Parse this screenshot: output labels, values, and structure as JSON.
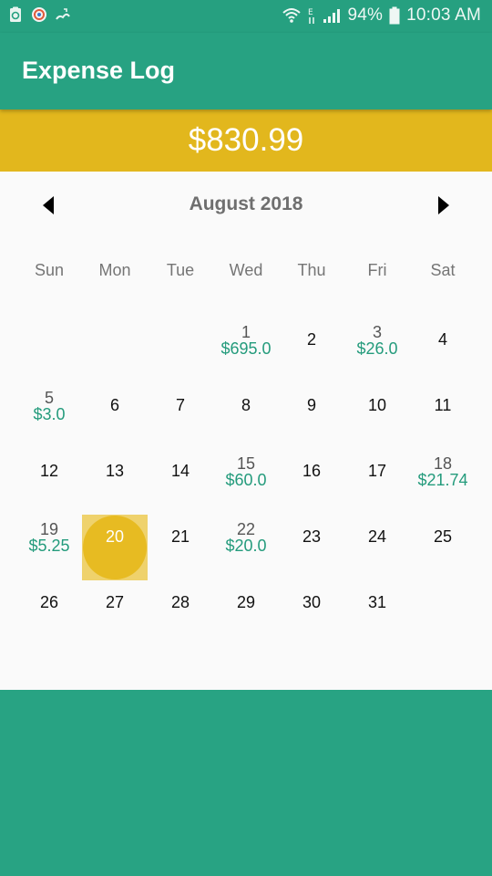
{
  "status_bar": {
    "battery": "94%",
    "time": "10:03 AM"
  },
  "app_bar": {
    "title": "Expense Log"
  },
  "total": {
    "amount": "$830.99"
  },
  "calendar": {
    "month_title": "August 2018",
    "weekdays": [
      "Sun",
      "Mon",
      "Tue",
      "Wed",
      "Thu",
      "Fri",
      "Sat"
    ],
    "days": [
      {
        "day": "1",
        "amount": "$695.0"
      },
      {
        "day": "2",
        "amount": ""
      },
      {
        "day": "3",
        "amount": "$26.0"
      },
      {
        "day": "4",
        "amount": ""
      },
      {
        "day": "5",
        "amount": "$3.0"
      },
      {
        "day": "6",
        "amount": ""
      },
      {
        "day": "7",
        "amount": ""
      },
      {
        "day": "8",
        "amount": ""
      },
      {
        "day": "9",
        "amount": ""
      },
      {
        "day": "10",
        "amount": ""
      },
      {
        "day": "11",
        "amount": ""
      },
      {
        "day": "12",
        "amount": ""
      },
      {
        "day": "13",
        "amount": ""
      },
      {
        "day": "14",
        "amount": ""
      },
      {
        "day": "15",
        "amount": "$60.0"
      },
      {
        "day": "16",
        "amount": ""
      },
      {
        "day": "17",
        "amount": ""
      },
      {
        "day": "18",
        "amount": "$21.74"
      },
      {
        "day": "19",
        "amount": "$5.25"
      },
      {
        "day": "20",
        "amount": "",
        "selected": true
      },
      {
        "day": "21",
        "amount": ""
      },
      {
        "day": "22",
        "amount": "$20.0"
      },
      {
        "day": "23",
        "amount": ""
      },
      {
        "day": "24",
        "amount": ""
      },
      {
        "day": "25",
        "amount": ""
      },
      {
        "day": "26",
        "amount": ""
      },
      {
        "day": "27",
        "amount": ""
      },
      {
        "day": "28",
        "amount": ""
      },
      {
        "day": "29",
        "amount": ""
      },
      {
        "day": "30",
        "amount": ""
      },
      {
        "day": "31",
        "amount": ""
      }
    ]
  }
}
